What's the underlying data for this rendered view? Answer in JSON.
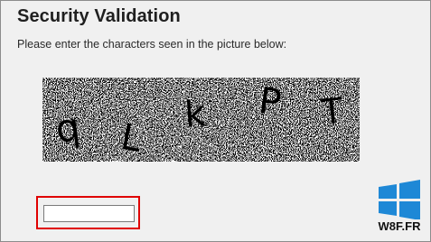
{
  "dialog": {
    "title": "Security Validation",
    "prompt": "Please enter the characters seen in the picture below:"
  },
  "captcha": {
    "characters": [
      "q",
      "L",
      "k",
      "P",
      "T"
    ],
    "colors": {
      "noise_dark": "#000000",
      "noise_light": "#ffffff",
      "glyph": "#000000"
    }
  },
  "answer_field": {
    "value": "",
    "placeholder": "",
    "highlight_color": "#e00000"
  },
  "watermark": {
    "text": "W8F.FR",
    "icon": "windows-logo-icon",
    "icon_color": "#1e88d6"
  }
}
